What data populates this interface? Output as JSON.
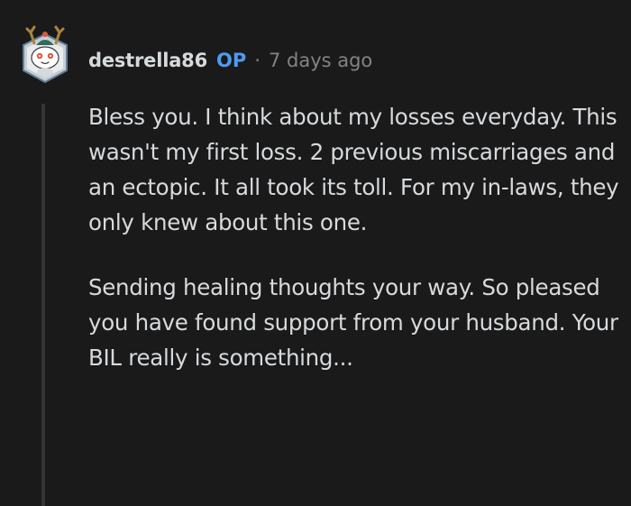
{
  "comment": {
    "author": "destrella86",
    "op_badge": "OP",
    "separator": "·",
    "timestamp": "7 days ago",
    "paragraphs": [
      "Bless you. I think about my losses everyday. This wasn't my first loss. 2 previous miscarriages and an ectopic. It all took its toll. For my in-laws, they only knew about this one.",
      "Sending healing thoughts your way. So pleased you have found support from your husband. Your BIL really is something..."
    ]
  },
  "colors": {
    "background": "#1a1a1b",
    "text": "#d7dadc",
    "meta": "#818384",
    "op_accent": "#4e9bf0",
    "thread_line": "#343536"
  },
  "icons": {
    "avatar": "snoo-avatar-icon"
  }
}
